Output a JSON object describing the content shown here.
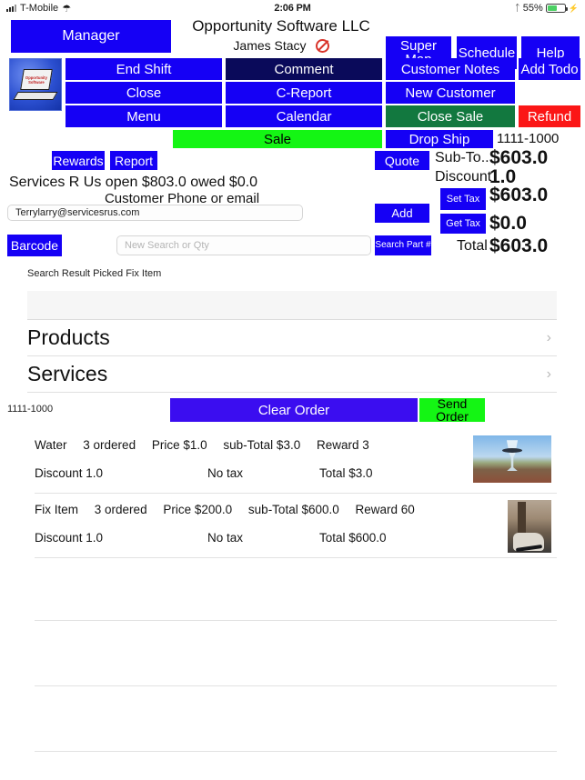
{
  "statusbar": {
    "carrier": "T-Mobile",
    "time": "2:06 PM",
    "battery_percent": "55%",
    "wifi_icon": "wifi-icon",
    "bluetooth_icon": "bluetooth-icon"
  },
  "header": {
    "manager_label": "Manager",
    "company": "Opportunity Software LLC",
    "user_name": "James Stacy",
    "status_icon": "no-entry-icon",
    "super_map_label": "Super Map",
    "schedule_label": "Schedule",
    "help_label": "Help",
    "logo_text": "Opportunity Software"
  },
  "actions": {
    "end_shift": "End Shift",
    "close": "Close",
    "menu": "Menu",
    "comment": "Comment",
    "c_report": "C-Report",
    "calendar": "Calendar",
    "customer_notes": "Customer Notes",
    "new_customer": "New Customer",
    "close_sale": "Close Sale",
    "add_todo": "Add Todo",
    "refund": "Refund",
    "sale": "Sale",
    "drop_ship": "Drop Ship",
    "order_number": "1111-1000",
    "rewards": "Rewards",
    "report": "Report",
    "quote": "Quote",
    "add": "Add",
    "barcode": "Barcode",
    "search_part": "Search Part #",
    "set_tax": "Set Tax",
    "get_tax": "Get Tax"
  },
  "customer": {
    "summary": "Services R Us  open $803.0 owed $0.0",
    "prompt": "Customer Phone or email",
    "email_value": "Terrylarry@servicesrus.com",
    "email_placeholder": "Customer Phone or email"
  },
  "search": {
    "placeholder": "New Search or Qty",
    "value": "",
    "result_text": "Search Result Picked Fix Item"
  },
  "totals": {
    "sub_label": "Sub-To...",
    "sub_value": "$603.0",
    "discount_label": "Discount",
    "discount_value": "1.0",
    "tax_value": "$603.0",
    "tax2_value": "$0.0",
    "total_label": "Total",
    "total_value": "$603.0"
  },
  "categories": [
    {
      "label": "Products",
      "chevron": "chevron-right-icon"
    },
    {
      "label": "Services",
      "chevron": "chevron-right-icon"
    }
  ],
  "order": {
    "order_number": "1111-1000",
    "clear_label": "Clear Order",
    "send_label": "Send Order"
  },
  "items": [
    {
      "name": "Water",
      "qty": "3 ordered",
      "price": "Price $1.0",
      "subtotal": "sub-Total $3.0",
      "reward": "Reward 3",
      "discount": "Discount 1.0",
      "tax": "No tax",
      "total": "Total $3.0",
      "thumb": "wine-glass-landscape-photo"
    },
    {
      "name": "Fix Item",
      "qty": "3 ordered",
      "price": "Price $200.0",
      "subtotal": "sub-Total $600.0",
      "reward": "Reward 60",
      "discount": "Discount 1.0",
      "tax": "No tax",
      "total": "Total $600.0",
      "thumb": "patio-furniture-photo"
    }
  ],
  "colors": {
    "primary_blue": "#1500f5",
    "navy": "#0a0a5a",
    "green": "#12783f",
    "lime": "#14f514",
    "red": "#fb1616",
    "clear_order_blue": "#3b0df0"
  }
}
